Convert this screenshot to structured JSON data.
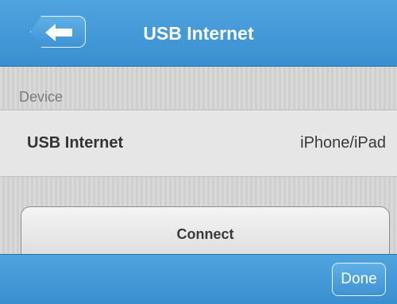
{
  "navbar": {
    "title": "USB Internet",
    "back_icon": "back-arrow-icon",
    "color": "#3a8fd0"
  },
  "section": {
    "header": "Device"
  },
  "row": {
    "label": "USB Internet",
    "value": "iPhone/iPad"
  },
  "connect": {
    "label": "Connect"
  },
  "bottombar": {
    "done_label": "Done"
  }
}
